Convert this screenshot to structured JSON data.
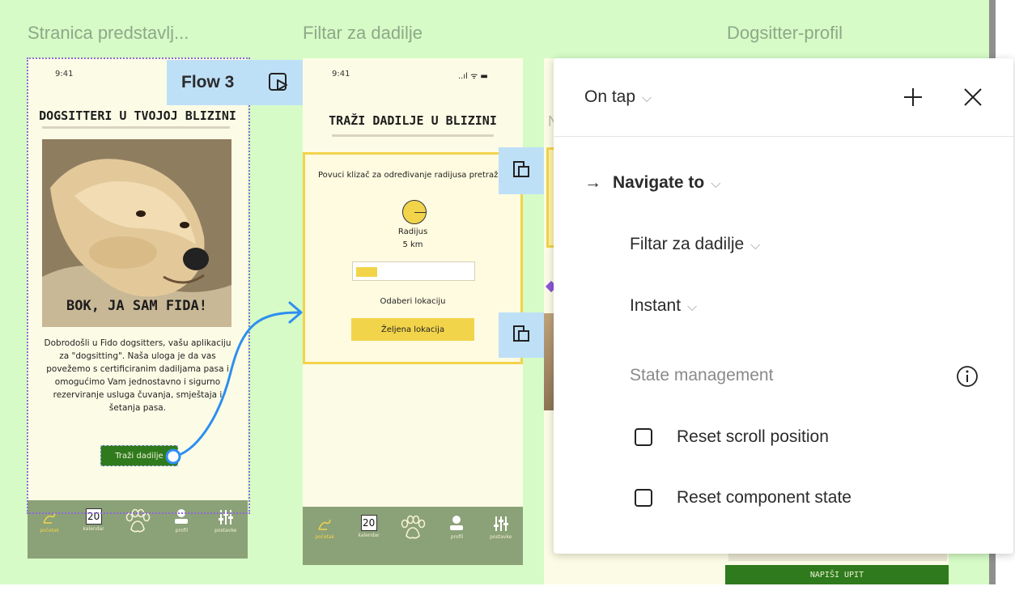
{
  "frames": {
    "frame1_title": "Stranica predstavlj...",
    "frame2_title": "Filtar za dadilje",
    "frame3_title": "Dogsitter-profil"
  },
  "flow_badge": {
    "label": "Flow 3",
    "icon": "play-frame-icon"
  },
  "phone1": {
    "time": "9:41",
    "heading": "DOGSITTERI U TVOJOJ BLIZINI",
    "photo_caption": "BOK, JA SAM FIDA!",
    "description": "Dobrodošli u Fido dogsitters, vašu aplikaciju za \"dogsitting\". Naša uloga je da vas povežemo s certificiranim dadiljama pasa i omogućimo Vam jednostavno i sigurno rezerviranje usluga čuvanja, smještaja i šetanja pasa.",
    "button": "Traži dadilje"
  },
  "phone2": {
    "time": "9:41",
    "status": "..ıl ᯤ ▬",
    "heading": "TRAŽI DADILJE U BLIZINI",
    "slider_hint": "Povuci klizač za određivanje radijusa pretraživanja",
    "radius_label": "Radijus",
    "radius_value": "5 km",
    "slider_fill": 0.18,
    "location_label": "Odaberi lokaciju",
    "location_button": "Željena lokacija"
  },
  "phone3": {
    "partial_letter": "N",
    "button": "NAPIŠI UPIT"
  },
  "navbar": {
    "items": [
      {
        "label": "početak",
        "icon": "home-icon",
        "active": true
      },
      {
        "label": "kalendar",
        "icon": "calendar-icon",
        "day": "20"
      },
      {
        "label": "",
        "icon": "paw-icon"
      },
      {
        "label": "profil",
        "icon": "profile-icon"
      },
      {
        "label": "postavke",
        "icon": "settings-sliders-icon"
      }
    ]
  },
  "panel": {
    "trigger": "On tap",
    "add_icon": "plus-icon",
    "close_icon": "close-icon",
    "action": "Navigate to",
    "destination": "Filtar za dadilje",
    "animation": "Instant",
    "state_management": "State management",
    "info_icon": "info-icon",
    "options": [
      {
        "label": "Reset scroll position",
        "checked": false
      },
      {
        "label": "Reset component state",
        "checked": false
      }
    ]
  },
  "colors": {
    "canvas": "#d6fbc6",
    "phone_bg": "#fcfce6",
    "navbar": "#8ba177",
    "accent_yellow": "#f2d44b",
    "flow_blue": "#2d8ff0",
    "badge_blue": "#bee0f7",
    "button_green": "#2f7a1c"
  }
}
